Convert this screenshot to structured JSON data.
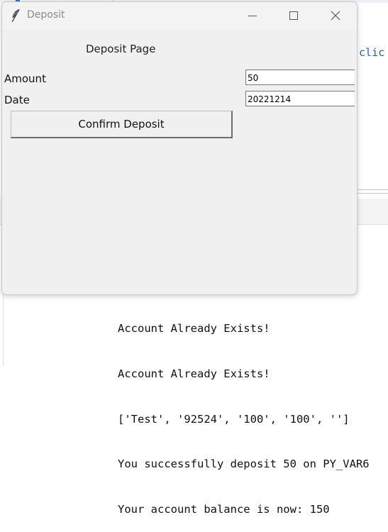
{
  "background": {
    "code_fragment": "clic",
    "console_lines": [
      "Account Already Exists!",
      "Account Already Exists!",
      "['Test', '92524', '100', '100', '']",
      "You successfully deposit 50 on PY_VAR6",
      "Your account balance is now: 150"
    ]
  },
  "window": {
    "title": "Deposit",
    "app_icon": "feather-icon",
    "controls": [
      "minimize-icon",
      "maximize-icon",
      "close-icon"
    ]
  },
  "form": {
    "heading": "Deposit Page",
    "amount_label": "Amount",
    "amount_value": "50",
    "date_label": "Date",
    "date_value": "20221214",
    "confirm_label": "Confirm Deposit"
  },
  "colors": {
    "window_bg": "#f0f0f0",
    "code_accent": "#2a5db0"
  }
}
